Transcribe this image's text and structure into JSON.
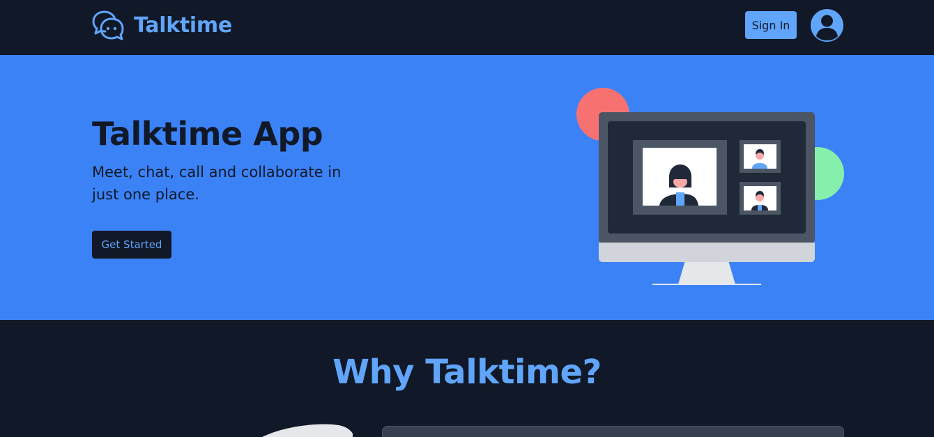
{
  "brand": {
    "name": "Talktime",
    "logo_icon": "chat-bubbles-icon"
  },
  "nav": {
    "signin_label": "Sign In",
    "avatar_icon": "user-avatar-icon"
  },
  "hero": {
    "title": "Talktime App",
    "subtitle": "Meet, chat, call and collaborate in just one place.",
    "cta_label": "Get Started",
    "illustration": "video-call-monitor-illustration"
  },
  "why": {
    "title": "Why Talktime?"
  },
  "colors": {
    "navy": "#111827",
    "accent": "#60a5fa",
    "hero_bg": "#3b82f6",
    "circle_red": "#f87171",
    "circle_green": "#86efac"
  }
}
